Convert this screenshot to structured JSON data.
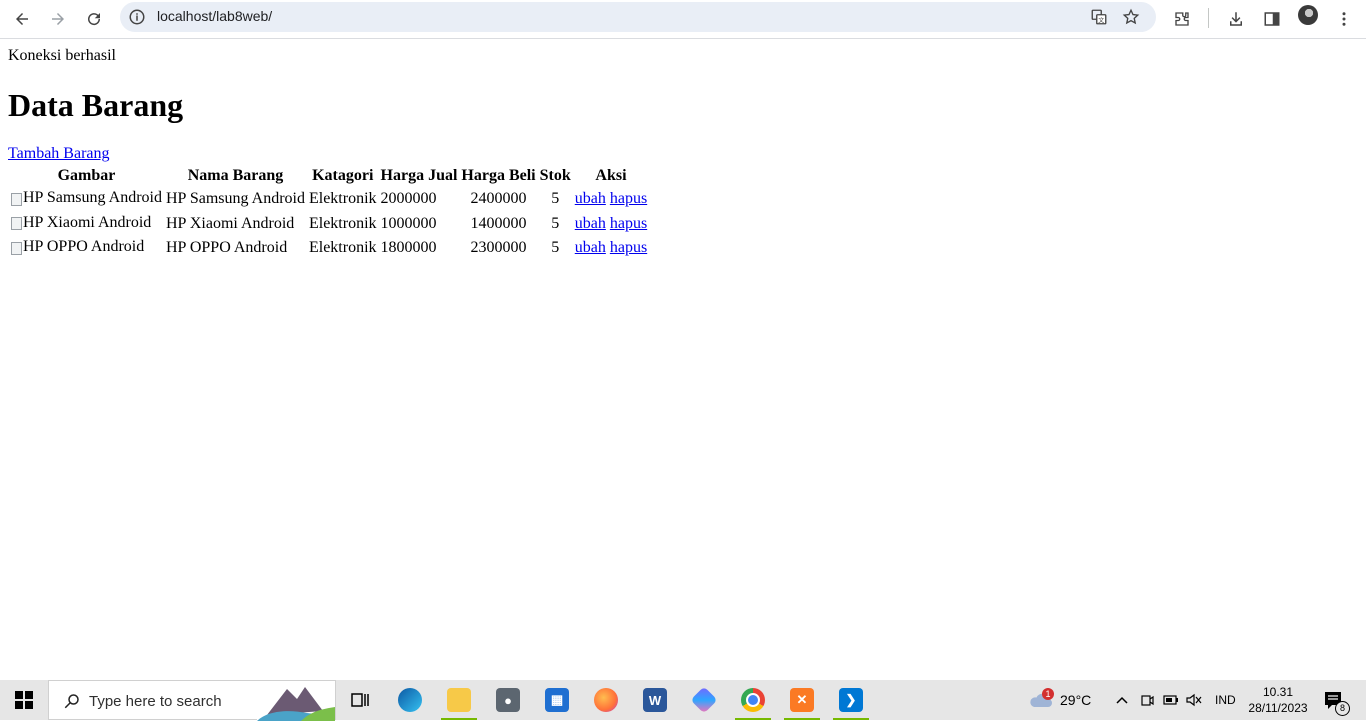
{
  "browser": {
    "url": "localhost/lab8web/",
    "icons": [
      "back-icon",
      "forward-icon",
      "reload-icon",
      "site-info-icon",
      "translate-icon",
      "bookmark-star-icon",
      "extensions-icon",
      "download-icon",
      "side-panel-icon",
      "profile-avatar",
      "menu-kebab-icon"
    ]
  },
  "page": {
    "status": "Koneksi berhasil",
    "title": "Data Barang",
    "add_link": "Tambah Barang",
    "headers": [
      "Gambar",
      "Nama Barang",
      "Katagori",
      "Harga Jual",
      "Harga Beli",
      "Stok",
      "Aksi"
    ],
    "rows": [
      {
        "gambar_alt": "HP Samsung Android",
        "nama": "HP Samsung Android",
        "kategori": "Elektronik",
        "harga_jual": "2000000",
        "harga_beli": "2400000",
        "stok": "5",
        "ubah": "ubah",
        "hapus": "hapus"
      },
      {
        "gambar_alt": "HP Xiaomi Android",
        "nama": "HP Xiaomi Android",
        "kategori": "Elektronik",
        "harga_jual": "1000000",
        "harga_beli": "1400000",
        "stok": "5",
        "ubah": "ubah",
        "hapus": "hapus"
      },
      {
        "gambar_alt": "HP OPPO Android",
        "nama": "HP OPPO Android",
        "kategori": "Elektronik",
        "harga_jual": "1800000",
        "harga_beli": "2300000",
        "stok": "5",
        "ubah": "ubah",
        "hapus": "hapus"
      }
    ],
    "link_color": "#0000ee"
  },
  "taskbar": {
    "search_placeholder": "Type here to search",
    "weather_temp": "29°C",
    "weather_badge": "1",
    "language": "IND",
    "time": "10.31",
    "date": "28/11/2023",
    "notification_count": "8",
    "apps": [
      "task-view",
      "edge",
      "file-explorer",
      "camera",
      "microsoft-store",
      "firefox",
      "word",
      "copilot",
      "chrome",
      "xampp",
      "vscode"
    ]
  }
}
